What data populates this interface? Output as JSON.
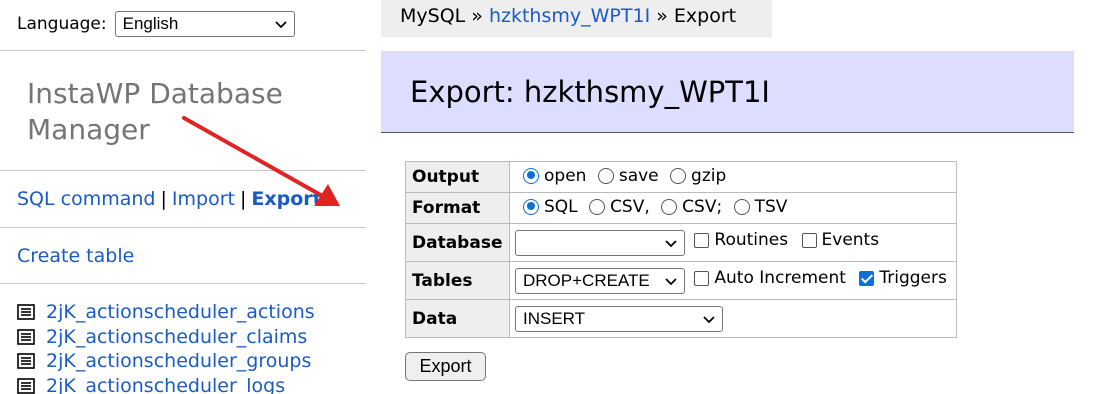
{
  "sidebar": {
    "language_label": "Language:",
    "language_value": "English",
    "app_title": "InstaWP Database Manager",
    "nav": {
      "sql_command": "SQL command",
      "separator": "|",
      "import": "Import",
      "export": "Export"
    },
    "create_table": "Create table",
    "tables": [
      "2jK_actionscheduler_actions",
      "2jK_actionscheduler_claims",
      "2jK_actionscheduler_groups",
      "2jK_actionscheduler_logs"
    ]
  },
  "breadcrumb": {
    "root": "MySQL",
    "sep": "»",
    "database": "hzkthsmy_WPT1I",
    "current": "Export"
  },
  "page_title": "Export: hzkthsmy_WPT1I",
  "form": {
    "output": {
      "label": "Output",
      "options": [
        "open",
        "save",
        "gzip"
      ],
      "selected": "open"
    },
    "format": {
      "label": "Format",
      "options": [
        "SQL",
        "CSV,",
        "CSV;",
        "TSV"
      ],
      "selected": "SQL"
    },
    "database": {
      "label": "Database",
      "select_value": "",
      "routines": "Routines",
      "events": "Events"
    },
    "tables": {
      "label": "Tables",
      "select_value": "DROP+CREATE",
      "auto_increment": "Auto Increment",
      "triggers": "Triggers"
    },
    "data": {
      "label": "Data",
      "select_value": "INSERT"
    },
    "submit": "Export"
  },
  "colors": {
    "link": "#1a5bc4",
    "header_bg": "#ddddff",
    "accent": "#0b6fd6",
    "annotation_arrow": "#e02424"
  }
}
